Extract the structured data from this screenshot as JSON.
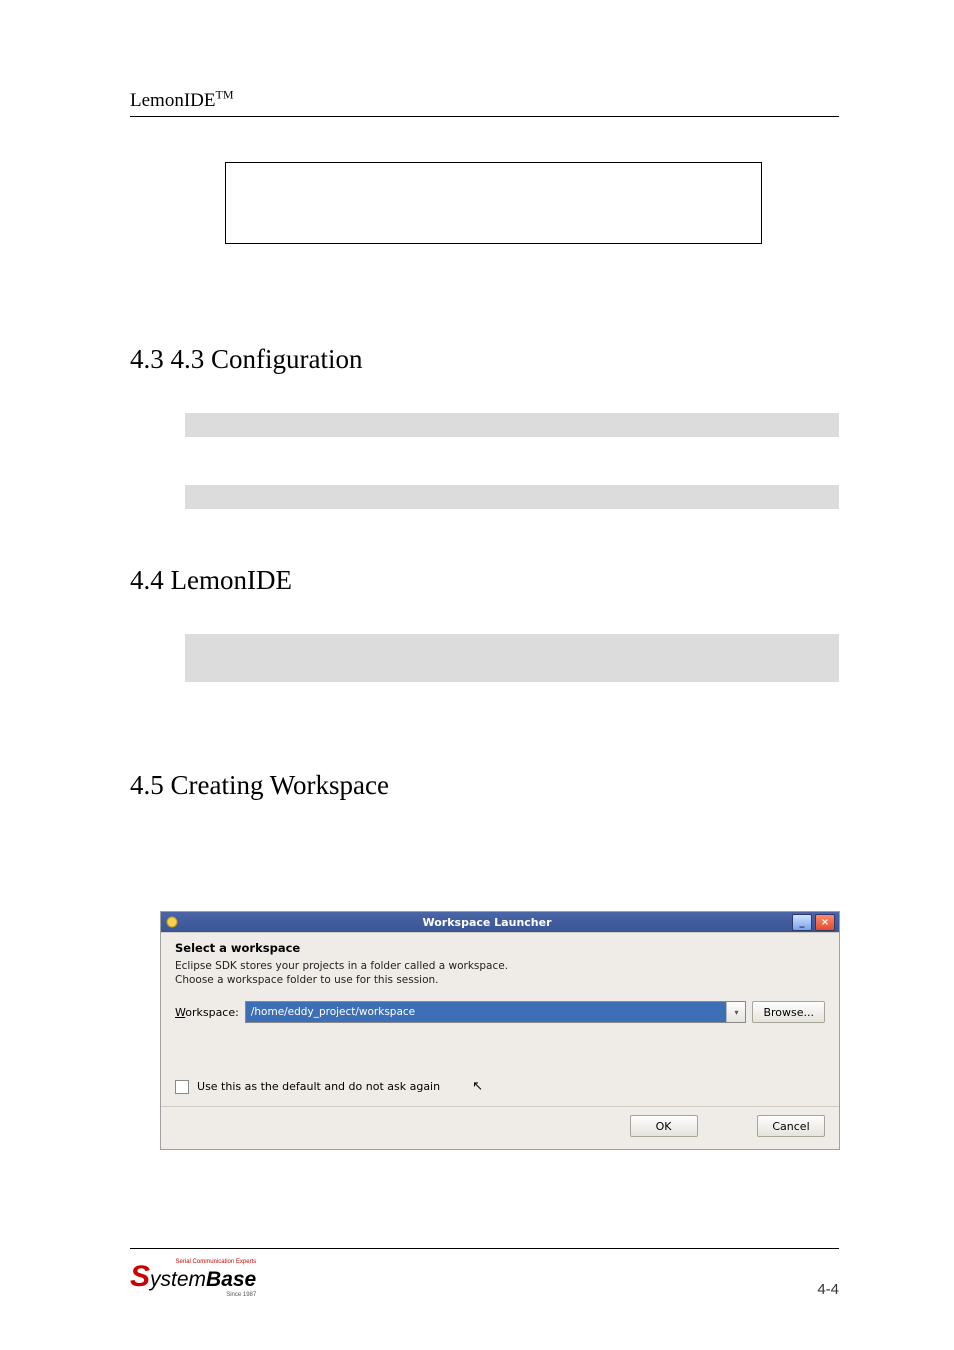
{
  "header": {
    "brand": "LemonIDE",
    "trademark": "TM"
  },
  "sections": {
    "s43": "4.3 4.3 Configuration",
    "s44": "4.4 LemonIDE",
    "s45": "4.5 Creating Workspace"
  },
  "dialog": {
    "title": "Workspace Launcher",
    "heading": "Select a workspace",
    "desc1": "Eclipse SDK stores your projects in a folder called a workspace.",
    "desc2": "Choose a workspace folder to use for this session.",
    "workspace_label_pre": "W",
    "workspace_label_post": "orkspace:",
    "workspace_value": "/home/eddy_project/workspace",
    "browse_pre": "B",
    "browse_post": "rowse...",
    "use_default_pre": "U",
    "use_default_post": "se this as the default and do not ask again",
    "ok": "OK",
    "cancel": "Cancel",
    "dd_glyph": "▾",
    "min_glyph": "_",
    "close_glyph": "×",
    "cursor_glyph": "↖"
  },
  "footer": {
    "page": "4-4",
    "logo_top": "Serial Communication Experts",
    "logo_s": "S",
    "logo_mid": "ystem",
    "logo_b": "Base",
    "logo_bot": "Since 1987"
  }
}
